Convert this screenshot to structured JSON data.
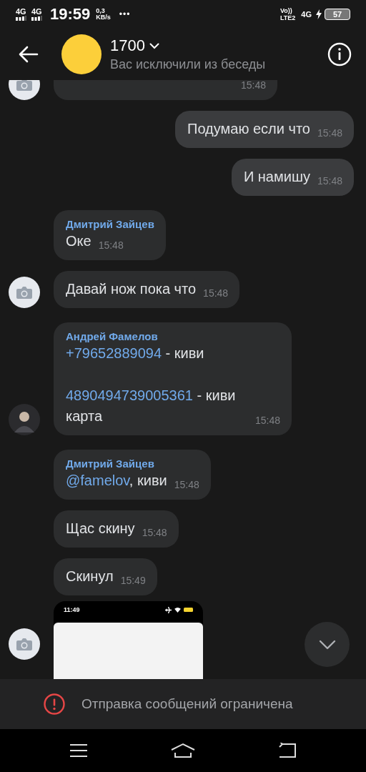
{
  "status_bar": {
    "sim_1": "4G",
    "sim_2": "4G",
    "time": "19:59",
    "speed_value": "0,3",
    "speed_unit": "KB/s",
    "more": "•••",
    "volte": "Vo))",
    "lte": "LTE2",
    "network": "4G",
    "battery": "57"
  },
  "header": {
    "title": "1700",
    "subtitle": "Вас исключили из беседы"
  },
  "messages": [
    {
      "kind": "text",
      "outgoing": false,
      "avatar": {
        "kind": "camera"
      },
      "time": "15:48"
    },
    {
      "kind": "text",
      "outgoing": true,
      "paragraphs": [
        [
          {
            "text": "Подумаю если что"
          }
        ]
      ],
      "time": "15:48"
    },
    {
      "kind": "text",
      "outgoing": true,
      "paragraphs": [
        [
          {
            "text": "И намишу"
          }
        ]
      ],
      "time": "15:48"
    },
    {
      "kind": "text",
      "outgoing": false,
      "sender": "Дмитрий Зайцев",
      "paragraphs": [
        [
          {
            "text": "Оке"
          }
        ]
      ],
      "time": "15:48"
    },
    {
      "kind": "text",
      "outgoing": false,
      "avatar": {
        "kind": "camera"
      },
      "paragraphs": [
        [
          {
            "text": "Давай нож пока что"
          }
        ]
      ],
      "time": "15:48"
    },
    {
      "kind": "text",
      "outgoing": false,
      "avatar": {
        "kind": "photo"
      },
      "sender": "Андрей Фамелов",
      "paragraphs": [
        [
          {
            "text": "+79652889094",
            "link": true
          },
          {
            "text": " - киви"
          }
        ],
        [
          {
            "text": "4890494739005361",
            "link": true
          },
          {
            "text": " - киви карта"
          }
        ]
      ],
      "time": "15:48"
    },
    {
      "kind": "text",
      "outgoing": false,
      "sender": "Дмитрий Зайцев",
      "paragraphs": [
        [
          {
            "text": "@famelov",
            "link": true
          },
          {
            "text": ", киви"
          }
        ]
      ],
      "time": "15:48"
    },
    {
      "kind": "text",
      "outgoing": false,
      "paragraphs": [
        [
          {
            "text": "Щас скину"
          }
        ]
      ],
      "time": "15:48"
    },
    {
      "kind": "text",
      "outgoing": false,
      "paragraphs": [
        [
          {
            "text": "Скинул"
          }
        ]
      ],
      "time": "15:49"
    },
    {
      "kind": "image",
      "outgoing": false,
      "avatar": {
        "kind": "camera"
      },
      "screenshot_time": "11:49"
    }
  ],
  "restriction": {
    "text": "Отправка сообщений ограничена"
  }
}
